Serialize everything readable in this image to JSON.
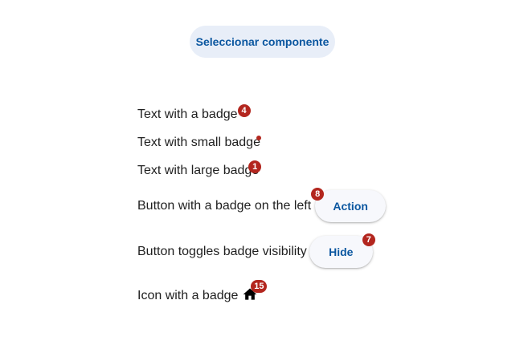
{
  "header": {
    "select_button_label": "Seleccionar componente"
  },
  "rows": {
    "text_badge": {
      "label": "Text with a badge",
      "badge": "4"
    },
    "small_badge": {
      "label": "Text with small badge"
    },
    "large_badge": {
      "label": "Text with large badge",
      "badge": "1"
    },
    "button_left_badge": {
      "label": "Button with a badge on the left",
      "button_label": "Action",
      "badge": "8"
    },
    "toggle_badge": {
      "label": "Button toggles badge visibility",
      "button_label": "Hide",
      "badge": "7"
    },
    "icon_badge": {
      "label": "Icon with a badge",
      "icon": "home-icon",
      "badge": "15"
    }
  },
  "colors": {
    "badge": "#b3261e",
    "primary_text": "#0b57a0",
    "tonal_button_bg": "#e8eef8"
  }
}
